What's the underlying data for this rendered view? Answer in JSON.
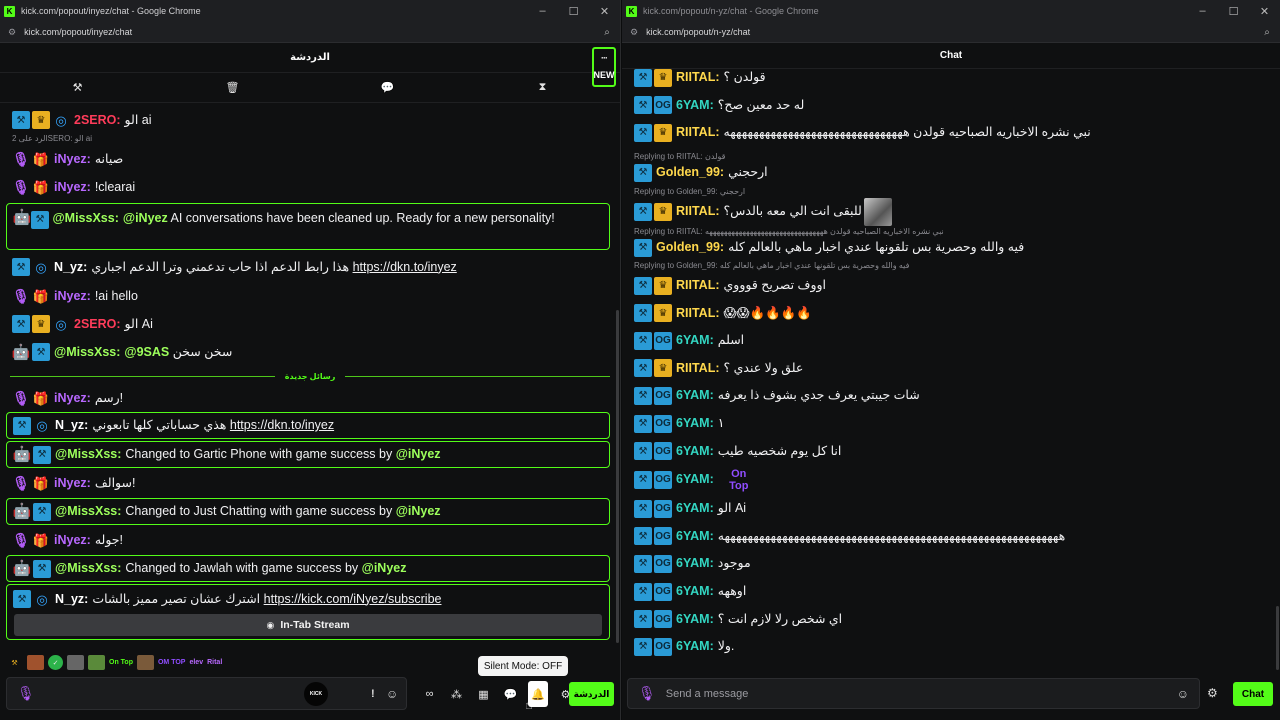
{
  "left_window": {
    "title": "kick.com/popout/inyez/chat - Google Chrome",
    "url": "kick.com/popout/inyez/chat",
    "chat_header": "الدردشة",
    "more_button": "···",
    "new_tag": "NEW",
    "messages": [
      {
        "user": "2SERO",
        "text": "الو ai"
      },
      {
        "reply": "الرد على 2SERO: الو ai"
      },
      {
        "user": "iNyez",
        "text": "صيانه"
      },
      {
        "user": "iNyez",
        "text": "!clearai"
      },
      {
        "user": "@MissXss",
        "mention": "@iNyez",
        "text": "AI conversations have been cleaned up. Ready for a new personality!"
      },
      {
        "user": "N_yz",
        "text": "هذا رابط الدعم اذا حاب تدعمني وترا الدعم اجباري",
        "link": "https://dkn.to/inyez"
      },
      {
        "user": "iNyez",
        "text": "!ai hello"
      },
      {
        "user": "2SERO",
        "text": "الو Ai"
      },
      {
        "user": "@MissXss",
        "mention": "@9SAS",
        "text": "سخن سخن"
      },
      {
        "divider": "رسائل جديدة"
      },
      {
        "user": "iNyez",
        "text": "رسم!"
      },
      {
        "user": "N_yz",
        "text": "هذي حساباتي كلها تابعوني",
        "link": "https://dkn.to/inyez"
      },
      {
        "user": "@MissXss",
        "text": "Changed to Gartic Phone with game success by",
        "mention": "@iNyez"
      },
      {
        "user": "iNyez",
        "text": "سوالف!"
      },
      {
        "user": "@MissXss",
        "text": "Changed to Just Chatting with game success by",
        "mention": "@iNyez"
      },
      {
        "user": "iNyez",
        "text": "جوله!"
      },
      {
        "user": "@MissXss",
        "text": "Changed to Jawlah with game success by",
        "mention": "@iNyez"
      },
      {
        "user": "N_yz",
        "text": "اشترك عشان تصير مميز بالشات",
        "link": "https://kick.com/iNyez/subscribe"
      }
    ],
    "in_tab_stream": "In-Tab Stream",
    "emotes": [
      "On Top",
      "OM TOP",
      "elev",
      "Rital"
    ],
    "kick_label": "KICK",
    "tooltip": "Silent Mode: OFF",
    "send_label": "الدردشة"
  },
  "right_window": {
    "title": "kick.com/popout/n-yz/chat - Google Chrome",
    "url": "kick.com/popout/n-yz/chat",
    "chat_header": "Chat",
    "messages": [
      {
        "user": "RIITAL",
        "text": "قولدن ؟"
      },
      {
        "user": "6YAM",
        "text": "له حد معين صح؟"
      },
      {
        "user": "RIITAL",
        "text": "نبي نشره الاخباريه الصباحيه قولدن هههههههههههههههههههههههههههههههه"
      },
      {
        "reply": "Replying to RIITAL: قولدن"
      },
      {
        "user": "Golden_99",
        "text": "ارحجني"
      },
      {
        "reply": "Replying to Golden_99: ارحجني"
      },
      {
        "user": "RIITAL",
        "text": "للبقى انت الي معه بالدس؟"
      },
      {
        "reply": "Replying to RIITAL: نبي نشره الاخباريه الصباحيه قولدن ههههههههههههههههههههههههههههههههه"
      },
      {
        "user": "Golden_99",
        "text": "فيه والله وحصرية بس تلقونها عندي اخبار ماهي بالعالم كله"
      },
      {
        "reply": "Replying to Golden_99: فيه والله وحصرية بس تلقونها عندي اخبار ماهي بالعالم كله"
      },
      {
        "user": "RIITAL",
        "text": "اووف تصريح قوووي"
      },
      {
        "user": "RIITAL",
        "text": "😱😱🔥🔥🔥🔥"
      },
      {
        "user": "6YAM",
        "text": "اسلم"
      },
      {
        "user": "RIITAL",
        "text": "علق ولا عندي ؟"
      },
      {
        "user": "6YAM",
        "text": "شات جيبتي يعرف جدي بشوف ذا يعرفه"
      },
      {
        "user": "6YAM",
        "text": "١"
      },
      {
        "user": "6YAM",
        "text": "انا كل يوم شخصيه طيب"
      },
      {
        "user": "6YAM",
        "text": "On Top"
      },
      {
        "user": "6YAM",
        "text": "الو Ai"
      },
      {
        "user": "6YAM",
        "text": "هههههههههههههههههههههههههههههههههههههههههههههههههههههههههههه"
      },
      {
        "user": "6YAM",
        "text": "موجود"
      },
      {
        "user": "6YAM",
        "text": "اوههه"
      },
      {
        "user": "6YAM",
        "text": "اي شخص رلا لازم انت ؟"
      },
      {
        "user": "6YAM",
        "text": "ولا."
      }
    ],
    "input_placeholder": "Send a message",
    "send_label": "Chat"
  },
  "colors": {
    "accent": "#53fc18",
    "mod_badge": "#2a9bd6",
    "vip_badge": "#e9b021",
    "username_red": "#ff3c5a",
    "username_purple": "#b868ff"
  }
}
